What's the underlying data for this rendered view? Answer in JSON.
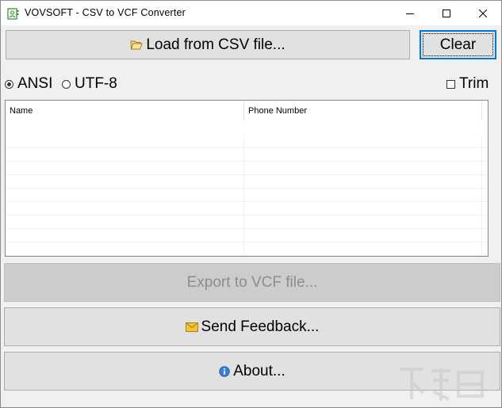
{
  "window": {
    "title": "VOVSOFT - CSV to VCF Converter",
    "minimize_label": "Minimize",
    "maximize_label": "Maximize",
    "close_label": "Close"
  },
  "toolbar": {
    "load_label": "Load from CSV file...",
    "clear_label": "Clear"
  },
  "encoding": {
    "options": [
      {
        "label": "ANSI",
        "selected": true
      },
      {
        "label": "UTF-8",
        "selected": false
      }
    ],
    "trim_label": "Trim",
    "trim_checked": false
  },
  "table": {
    "columns": [
      "Name",
      "Phone Number"
    ],
    "rows": [
      [
        "",
        ""
      ],
      [
        "",
        ""
      ],
      [
        "",
        ""
      ],
      [
        "",
        ""
      ],
      [
        "",
        ""
      ],
      [
        "",
        ""
      ],
      [
        "",
        ""
      ],
      [
        "",
        ""
      ],
      [
        "",
        ""
      ]
    ]
  },
  "actions": {
    "export_label": "Export to VCF file...",
    "export_enabled": false,
    "feedback_label": "Send Feedback...",
    "about_label": "About..."
  },
  "icons": {
    "app": "app-contact-icon",
    "load": "folder-open-icon",
    "feedback": "envelope-icon",
    "about": "info-icon"
  },
  "colors": {
    "focus_border": "#0078d7",
    "button_face": "#e1e1e1",
    "disabled_face": "#cccccc",
    "disabled_text": "#8d8d8d"
  }
}
